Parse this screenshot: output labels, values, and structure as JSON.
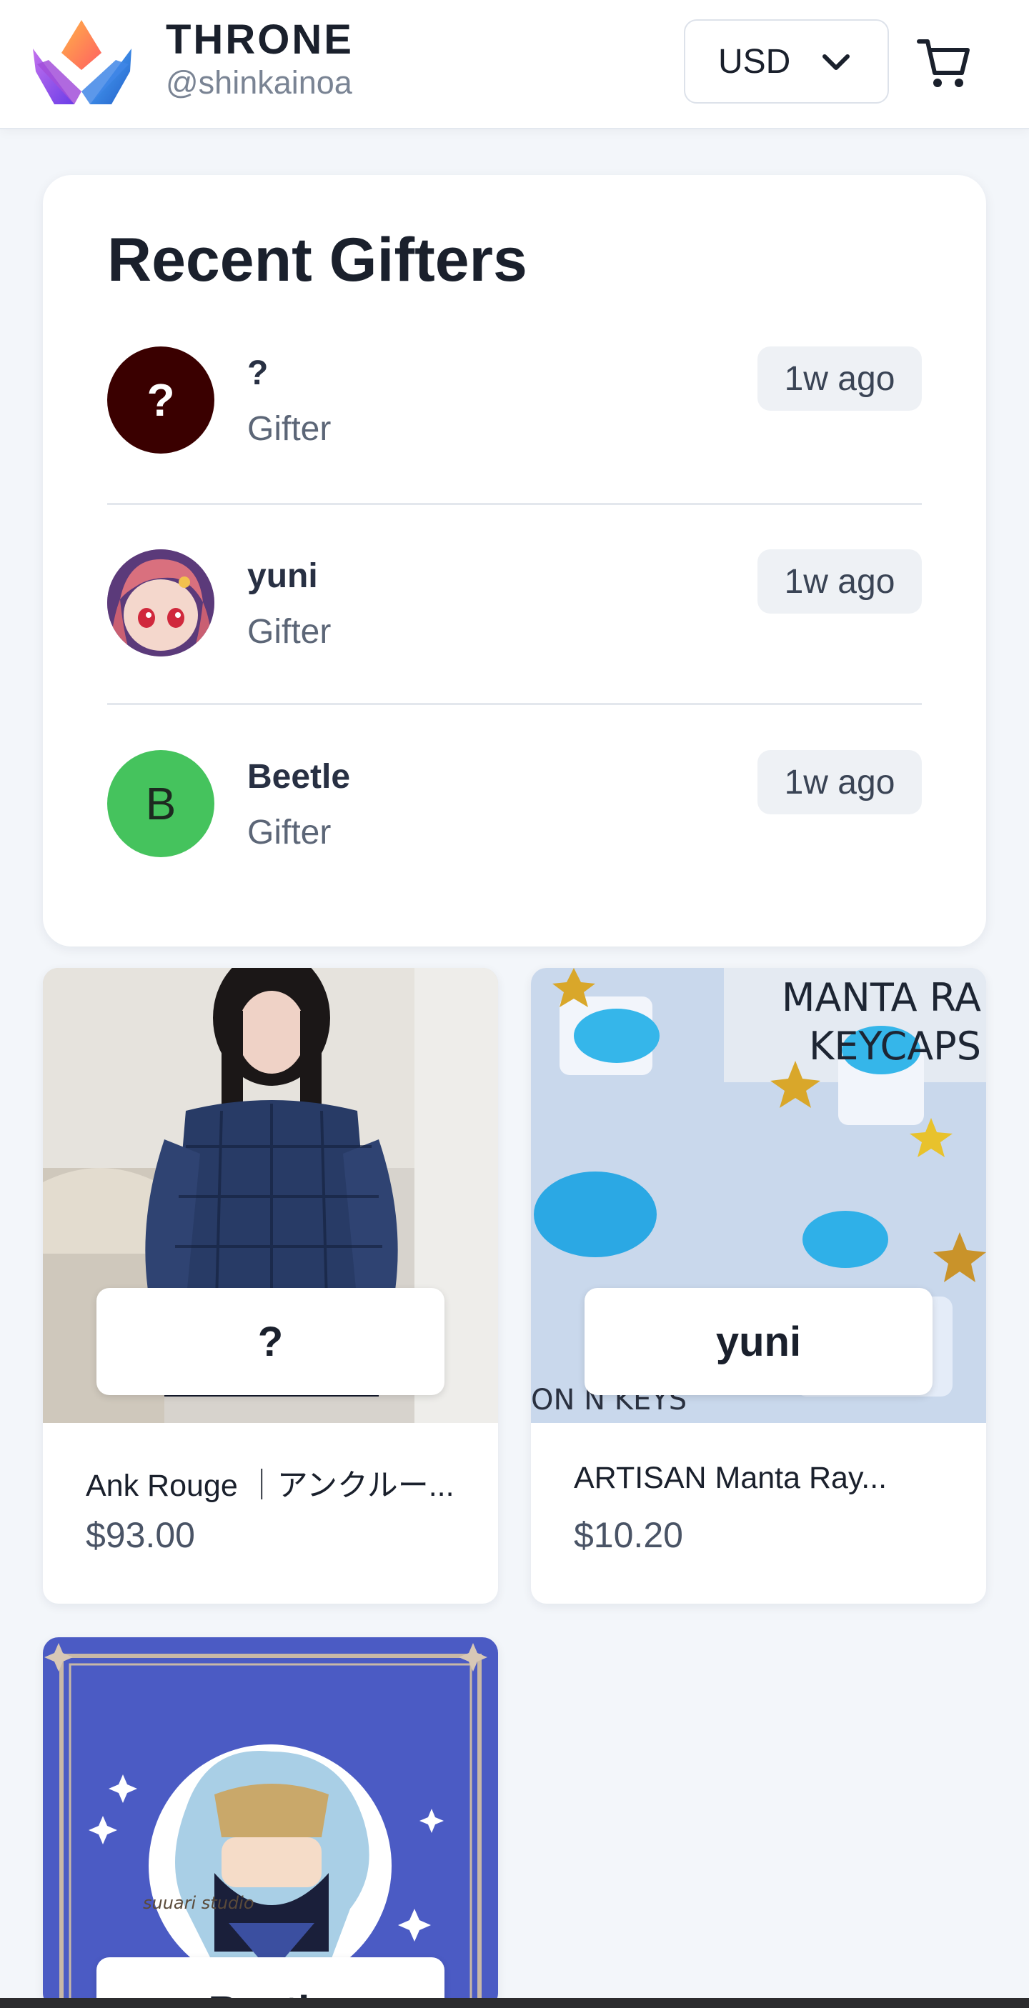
{
  "header": {
    "brand": "THRONE",
    "handle": "@shinkainoa",
    "currency": "USD"
  },
  "gifters": {
    "title": "Recent Gifters",
    "items": [
      {
        "name": "?",
        "role": "Gifter",
        "time": "1w ago",
        "avatar_text": "?",
        "avatar_color": "#3a0000"
      },
      {
        "name": "yuni",
        "role": "Gifter",
        "time": "1w ago",
        "avatar_text": "",
        "avatar_color": "#7d4a8a"
      },
      {
        "name": "Beetle",
        "role": "Gifter",
        "time": "1w ago",
        "avatar_text": "B",
        "avatar_color": "#45c35d"
      }
    ]
  },
  "products": [
    {
      "gifter": "?",
      "title": "Ank Rouge ｜アンクルー...",
      "price": "$93.00"
    },
    {
      "gifter": "yuni",
      "title": "ARTISAN Manta Ray...",
      "price": "$10.20",
      "image_text_1": "MANTA RA",
      "image_text_2": "KEYCAPS",
      "image_text_3": "ON N KEYS"
    },
    {
      "gifter": "Beetle",
      "image_text": "suuari studio"
    }
  ],
  "colors": {
    "page_bg": "#f3f6fa",
    "card_bg": "#ffffff",
    "badge_bg": "#eef1f5",
    "pin_card_bg": "#4b5bc4"
  },
  "icons": [
    "throne-logo-icon",
    "chevron-down-icon",
    "cart-icon"
  ]
}
